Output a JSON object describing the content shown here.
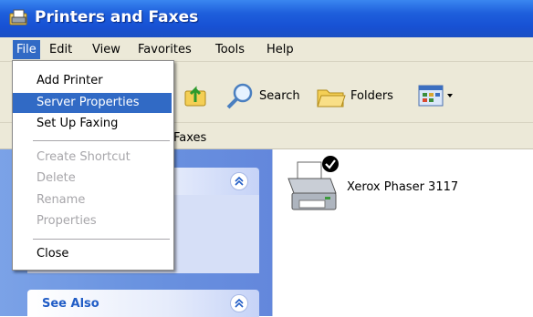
{
  "window": {
    "title": "Printers and Faxes"
  },
  "menubar": {
    "items": [
      {
        "label": "File"
      },
      {
        "label": "Edit"
      },
      {
        "label": "View"
      },
      {
        "label": "Favorites"
      },
      {
        "label": "Tools"
      },
      {
        "label": "Help"
      }
    ],
    "active": "File"
  },
  "toolbar": {
    "search_label": "Search",
    "folders_label": "Folders"
  },
  "address": {
    "text": "Faxes"
  },
  "file_menu": {
    "items": [
      {
        "label": "Add Printer",
        "state": "normal"
      },
      {
        "label": "Server Properties",
        "state": "highlighted"
      },
      {
        "label": "Set Up Faxing",
        "state": "normal"
      },
      {
        "label": "Create Shortcut",
        "state": "disabled"
      },
      {
        "label": "Delete",
        "state": "disabled"
      },
      {
        "label": "Rename",
        "state": "disabled"
      },
      {
        "label": "Properties",
        "state": "disabled"
      },
      {
        "label": "Close",
        "state": "normal"
      }
    ]
  },
  "tasks_pane": {
    "see_also_title": "See Also"
  },
  "printers": [
    {
      "name": "Xerox Phaser 3117",
      "is_default": true
    }
  ],
  "colors": {
    "titlebar": "#1e5fdc",
    "menu_highlight": "#316ac5",
    "taskpane_blue": "#6a93e0",
    "panel_title": "#215dc6"
  }
}
